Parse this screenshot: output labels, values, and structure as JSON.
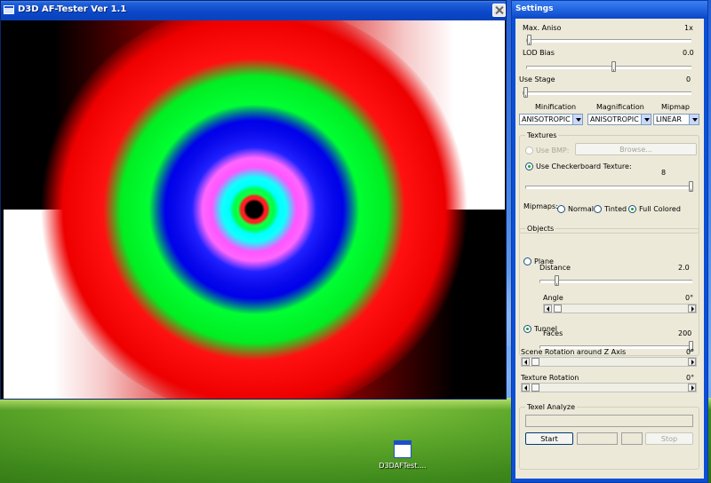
{
  "main_window": {
    "title": "D3D AF-Tester Ver 1.1"
  },
  "desktop": {
    "icon_label": "D3DAFTest....",
    "icon": "app-window-icon"
  },
  "settings": {
    "title": "Settings",
    "max_aniso": {
      "label": "Max. Aniso",
      "value": "1x"
    },
    "lod_bias": {
      "label": "LOD Bias",
      "value": "0.0"
    },
    "use_stage": {
      "label": "Use Stage",
      "value": "0"
    },
    "filters": {
      "minification": {
        "label": "Minification",
        "value": "ANISOTROPIC"
      },
      "magnification": {
        "label": "Magnification",
        "value": "ANISOTROPIC"
      },
      "mipmap": {
        "label": "Mipmap",
        "value": "LINEAR"
      }
    },
    "textures": {
      "title": "Textures",
      "use_bmp": "Use BMP:",
      "browse": "Browse...",
      "use_checkerboard": "Use Checkerboard Texture:",
      "checker_value": "8",
      "mipmaps_label": "Mipmaps:",
      "mip_normal": "Normal",
      "mip_tinted": "Tinted",
      "mip_full": "Full Colored",
      "selected": "Full Colored"
    },
    "objects": {
      "title": "Objects",
      "plane": "Plane",
      "distance_label": "Distance",
      "distance_value": "2.0",
      "angle_label": "Angle",
      "angle_value": "0°",
      "tunnel": "Tunnel",
      "faces_label": "Faces",
      "faces_value": "200",
      "selected": "Tunnel"
    },
    "scene_rotation": {
      "label": "Scene Rotation around Z Axis",
      "value": "0°"
    },
    "texture_rotation": {
      "label": "Texture Rotation",
      "value": "0°"
    },
    "texel_analyze": {
      "title": "Texel Analyze",
      "start": "Start",
      "stop": "Stop"
    }
  }
}
